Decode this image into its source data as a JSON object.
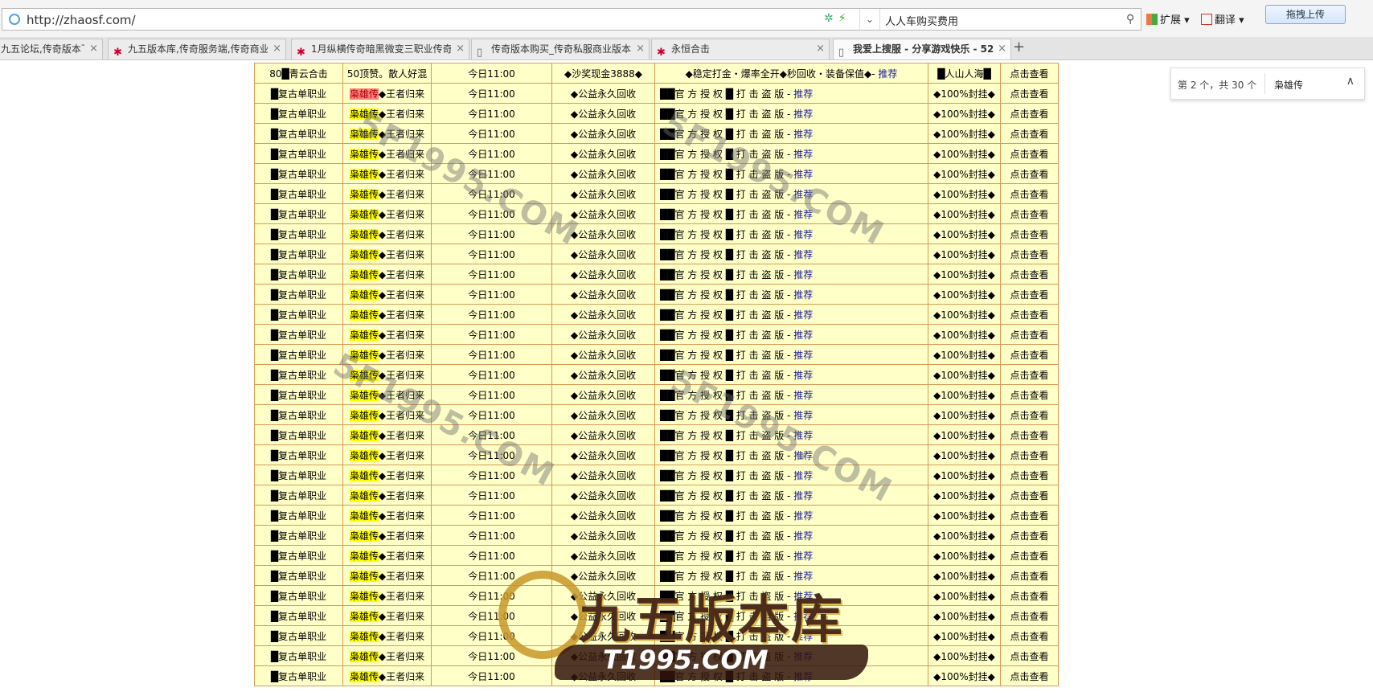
{
  "browser": {
    "url": "http://zhaosf.com/",
    "search_text": "人人车购买费用",
    "extensions": [
      "扩展",
      "翻译"
    ],
    "upload_label": "拖拽上传"
  },
  "tabs": [
    {
      "label": "九五论坛,传奇版本下载"
    },
    {
      "label": "九五版本库,传奇服务端,传奇商业"
    },
    {
      "label": "1月纵横传奇暗黑微变三职业传奇"
    },
    {
      "label": "传奇版本购买_传奇私服商业版本"
    },
    {
      "label": "永恒合击"
    },
    {
      "label": "我爱上搜服 - 分享游戏快乐 - 52",
      "active": true
    }
  ],
  "find": {
    "count_text": "第 2 个，共 30 个",
    "term": "枭雄传"
  },
  "first_row": {
    "name": "80█青云合击",
    "type": "50顶赞。散人好混",
    "time": "今日11:00",
    "route": "◆沙奖现金3888◆",
    "desc": "◆稳定打金・爆率全开◆秒回收・装备保值◆-",
    "rec": "推荐",
    "qq": "█人山人海█",
    "view": "点击查看"
  },
  "row": {
    "name": "█复古单职业",
    "type_hl": "枭雄传",
    "type_rest": "◆王者归来",
    "time": "今日11:00",
    "route": "◆公益永久回收",
    "desc": "██官 方 授 权 █ 打 击 盗 版 -",
    "rec": "推荐",
    "qq": "◆100%封挂◆",
    "view": "点击查看"
  },
  "watermarks": [
    "5F1995.COM",
    "5F1995.COM",
    "5F1995.COM",
    "5F1995.COM"
  ],
  "logo": {
    "title": "九五版本库",
    "domain": "T1995.COM"
  }
}
